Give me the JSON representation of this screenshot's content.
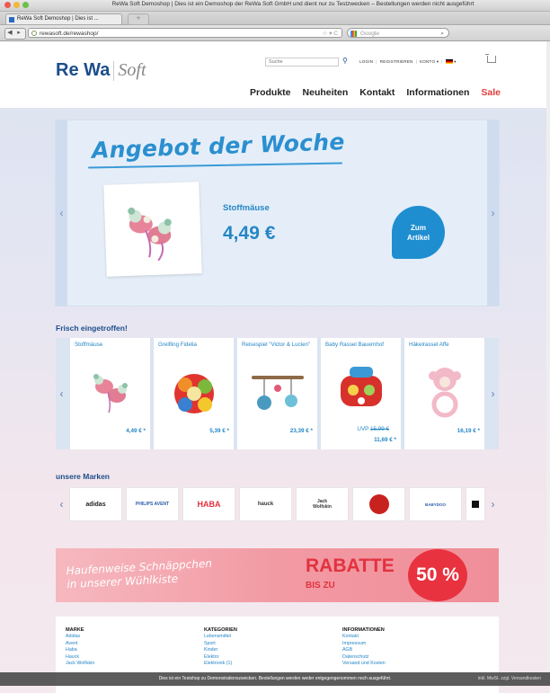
{
  "browser": {
    "window_title": "ReWa Soft Demoshop | Dies ist ein Demoshop der ReWa Soft GmbH und dient nur zu Testzwecken – Bestellungen werden nicht ausgeführt",
    "tab_title": "ReWa Soft Demoshop | Dies ist ...",
    "new_tab": "+",
    "url": "rewasoft.de/rewashop/",
    "search_engine_placeholder": "Google"
  },
  "header": {
    "logo_bold": "Re Wa",
    "logo_light": "Soft",
    "search_placeholder": "Suche",
    "top_links": [
      "LOGIN",
      "REGISTRIEREN",
      "KONTO ▾"
    ],
    "language": "▾",
    "nav": [
      "Produkte",
      "Neuheiten",
      "Kontakt",
      "Informationen",
      "Sale"
    ]
  },
  "hero": {
    "title": "Angebot der Woche",
    "product_name": "Stoffmäuse",
    "price": "4,49 €",
    "cta": "Zum\nArtikel"
  },
  "new_arrivals": {
    "title": "Frisch eingetroffen!",
    "products": [
      {
        "name": "Stoffmäuse",
        "price": "4,49 € *"
      },
      {
        "name": "Greifling Fidelia",
        "price": "5,39 € *"
      },
      {
        "name": "Reisespiel \"Victor & Lucien\"",
        "price": "23,39 € *"
      },
      {
        "name": "Baby Rassel Bauernhof",
        "uvp_label": "UVP",
        "uvp_price": "15,99 €",
        "price": "11,69 € *"
      },
      {
        "name": "Häkelrassel Affe",
        "price": "16,19 € *"
      }
    ]
  },
  "brands": {
    "title": "unsere Marken",
    "items": [
      "adidas",
      "PHILIPS AVENT",
      "HABA",
      "hauck",
      "Jack Wolfskin",
      "",
      "BABYDOO",
      ""
    ]
  },
  "banner": {
    "left_text": "Haufenweise Schnäppchen\nin unserer Wühlkiste",
    "rabatt": "RABATTE",
    "bis": "BIS ZU",
    "percent": "50 %"
  },
  "footer": {
    "columns": [
      {
        "heading": "MARKE",
        "links": [
          "Adidas",
          "Avent",
          "Haba",
          "Hauck",
          "Jack Wolfskin"
        ]
      },
      {
        "heading": "KATEGORIEN",
        "links": [
          "Lebensmittel",
          "Sport",
          "Kinder",
          "Elektro",
          "Elektronik (1)"
        ]
      },
      {
        "heading": "INFORMATIONEN",
        "links": [
          "Kontakt",
          "Impressum",
          "AGB",
          "Datenschutz",
          "Versand und Kosten"
        ]
      }
    ]
  },
  "notice": {
    "text": "Dies ist ein Testshop zu Demonstrationszwecken. Bestellungen werden weder entgegengenommen noch ausgeführt.",
    "right": "inkl. MwSt. zzgl. Versandkosten"
  },
  "colors": {
    "brand_blue": "#1c4d8b",
    "accent_blue": "#2586c6",
    "sale_red": "#e23a3a"
  }
}
